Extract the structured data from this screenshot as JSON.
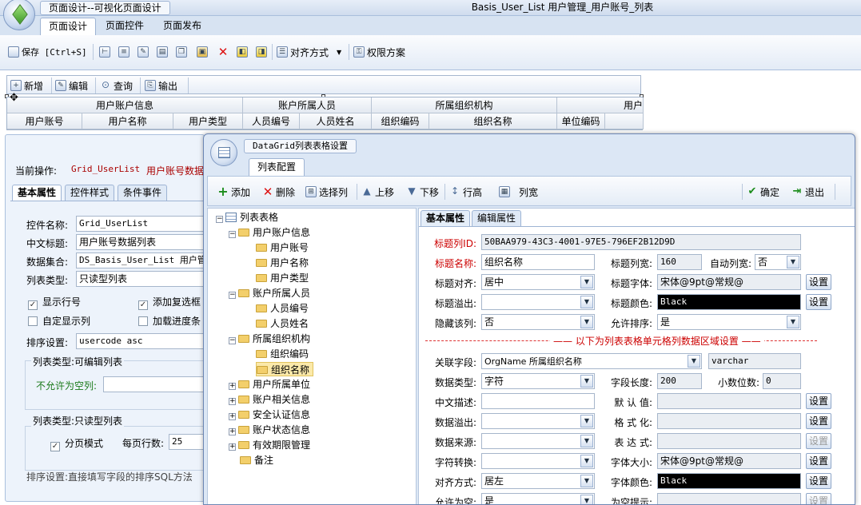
{
  "app": {
    "app_title": "页面设计--可视化页面设计",
    "window_title": "Basis_User_List  用户管理_用户账号_列表"
  },
  "ribbon": {
    "tabs": [
      "页面设计",
      "页面控件",
      "页面发布"
    ],
    "save_label": "保存 [Ctrl+S]",
    "align_label": "对齐方式",
    "permission_label": "权限方案"
  },
  "grid_toolbar": {
    "add": "新增",
    "edit": "编辑",
    "query": "查询",
    "export": "输出"
  },
  "grid_header": {
    "groups": [
      "用户账户信息",
      "账户所属人员",
      "所属组织机构",
      "用户"
    ],
    "columns": [
      "用户账号",
      "用户名称",
      "用户类型",
      "人员编号",
      "人员姓名",
      "组织编码",
      "组织名称",
      "单位编码"
    ]
  },
  "left_panel": {
    "current_op_label": "当前操作:",
    "current_op_value": "Grid_UserList",
    "current_op_desc": "用户账号数据",
    "tabs": [
      "基本属性",
      "控件样式",
      "条件事件"
    ],
    "control_name_label": "控件名称:",
    "control_name_value": "Grid_UserList",
    "cn_title_label": "中文标题:",
    "cn_title_value": "用户账号数据列表",
    "dataset_label": "数据集合:",
    "dataset_value": "DS_Basis_User_List  用户管",
    "list_type_label": "列表类型:",
    "list_type_value": "只读型列表",
    "show_row_no": "显示行号",
    "add_checkbox": "添加复选框",
    "custom_cols": "自定显示列",
    "load_progress": "加载进度条",
    "sort_label": "排序设置:",
    "sort_value": "usercode asc",
    "editable_group": "列表类型:可编辑列表",
    "not_null_label": "不允许为空列:",
    "readonly_group": "列表类型:只读型列表",
    "paging_label": "分页模式",
    "page_rows_label": "每页行数:",
    "page_rows_value": "25",
    "hint": "排序设置:直接填写字段的排序SQL方法"
  },
  "dialog": {
    "title": "DataGrid列表表格设置",
    "tab": "列表配置",
    "toolbar": {
      "add": "添加",
      "delete": "删除",
      "select_col": "选择列",
      "move_up": "上移",
      "move_down": "下移",
      "row_height": "行高",
      "col_width": "列宽",
      "ok": "确定",
      "exit": "退出"
    },
    "tree": {
      "root": "列表表格",
      "nodes": [
        {
          "label": "用户账户信息",
          "children": [
            "用户账号",
            "用户名称",
            "用户类型"
          ]
        },
        {
          "label": "账户所属人员",
          "children": [
            "人员编号",
            "人员姓名"
          ]
        },
        {
          "label": "所属组织机构",
          "children": [
            "组织编码",
            "组织名称"
          ]
        },
        {
          "label": "用户所属单位"
        },
        {
          "label": "账户相关信息"
        },
        {
          "label": "安全认证信息"
        },
        {
          "label": "账户状态信息"
        },
        {
          "label": "有效期限管理"
        },
        {
          "label": "备注"
        }
      ]
    },
    "props_tabs": [
      "基本属性",
      "编辑属性"
    ],
    "props": {
      "col_id_label": "标题列ID:",
      "col_id_value": "50BAA979-43C3-4001-97E5-796EF2B12D9D",
      "title_name_label": "标题名称:",
      "title_name_value": "组织名称",
      "title_width_label": "标题列宽:",
      "title_width_value": "160",
      "auto_width_label": "自动列宽:",
      "auto_width_value": "否",
      "title_align_label": "标题对齐:",
      "title_align_value": "居中",
      "title_font_label": "标题字体:",
      "title_font_value": "宋体@9pt@常规@",
      "title_overflow_label": "标题溢出:",
      "title_overflow_value": "",
      "title_color_label": "标题颜色:",
      "title_color_value": "Black",
      "hide_col_label": "隐藏该列:",
      "hide_col_value": "否",
      "allow_sort_label": "允许排序:",
      "allow_sort_value": "是",
      "divider": "以下为列表表格单元格列数据区域设置",
      "field_label": "关联字段:",
      "field_value": "OrgName  所属组织名称",
      "field_type": "varchar",
      "data_type_label": "数据类型:",
      "data_type_value": "字符",
      "field_len_label": "字段长度:",
      "field_len_value": "200",
      "decimals_label": "小数位数:",
      "decimals_value": "0",
      "cn_desc_label": "中文描述:",
      "default_label": "默 认 值:",
      "data_overflow_label": "数据溢出:",
      "format_label": "格 式 化:",
      "data_source_label": "数据来源:",
      "expr_label": "表 达 式:",
      "char_conv_label": "字符转换:",
      "font_size_label": "字体大小:",
      "font_size_value": "宋体@9pt@常规@",
      "align_label": "对齐方式:",
      "align_value": "居左",
      "font_color_label": "字体颜色:",
      "font_color_value": "Black",
      "allow_null_label": "允许为空:",
      "allow_null_value": "是",
      "null_hint_label": "为空提示:",
      "settings_btn": "设置"
    }
  }
}
